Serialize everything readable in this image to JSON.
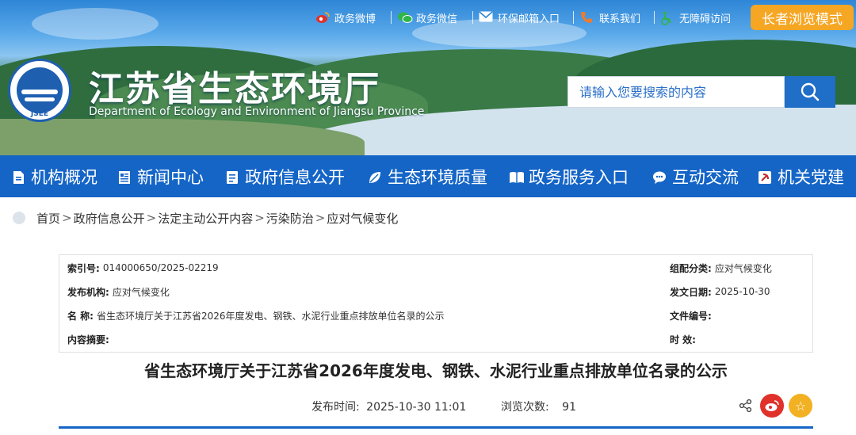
{
  "header": {
    "links": [
      "政务微博",
      "政务微信",
      "环保邮箱入口",
      "联系我们",
      "无障碍访问"
    ],
    "elder_mode": "长者浏览模式",
    "site_title": "江苏省生态环境厅",
    "site_subtitle": "Department of Ecology and Environment of Jiangsu Province",
    "logo_abbr": "JSEE",
    "search_placeholder": "请输入您要搜索的内容"
  },
  "nav": {
    "items": [
      "机构概况",
      "新闻中心",
      "政府信息公开",
      "生态环境质量",
      "政务服务入口",
      "互动交流",
      "机关党建"
    ]
  },
  "breadcrumb": [
    "首页",
    "政府信息公开",
    "法定主动公开内容",
    "污染防治",
    "应对气候变化"
  ],
  "info": {
    "index_label": "索引号:",
    "index_value": "014000650/2025-02219",
    "category_label": "组配分类:",
    "category_value": "应对气候变化",
    "publisher_label": "发布机构:",
    "publisher_value": "应对气候变化",
    "date_label": "发文日期:",
    "date_value": "2025-10-30",
    "name_label": "名 称:",
    "name_value": "省生态环境厅关于江苏省2026年度发电、钢铁、水泥行业重点排放单位名录的公示",
    "docno_label": "文件编号:",
    "docno_value": "",
    "abstract_label": "内容摘要:",
    "abstract_value": "",
    "validity_label": "时 效:",
    "validity_value": ""
  },
  "article": {
    "title": "省生态环境厅关于江苏省2026年度发电、钢铁、水泥行业重点排放单位名录的公示",
    "publish_label": "发布时间:",
    "publish_time": "2025-10-30 11:01",
    "views_label": "浏览次数:",
    "views": "91"
  },
  "colors": {
    "nav_blue": "#1565c7",
    "elder_orange": "#f5a623",
    "weibo_red": "#e0312b",
    "fav_yellow": "#f2b122"
  }
}
